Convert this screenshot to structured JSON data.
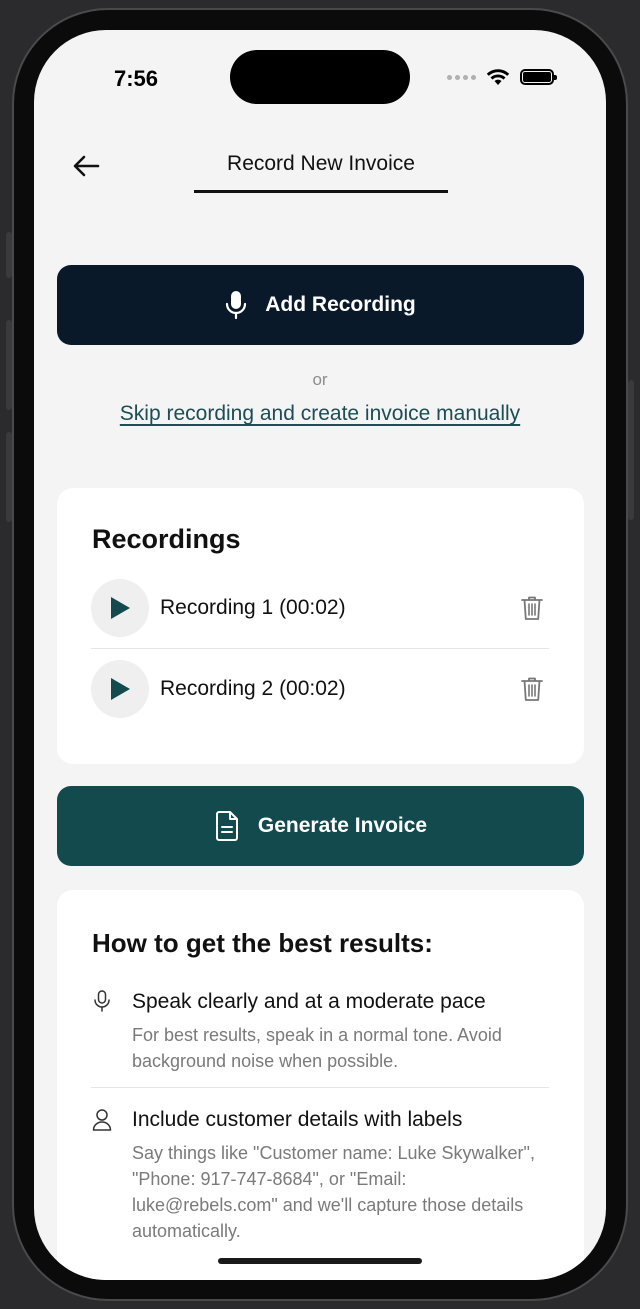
{
  "status_bar": {
    "time": "7:56"
  },
  "header": {
    "title": "Record New Invoice"
  },
  "actions": {
    "add_recording_label": "Add Recording",
    "or_label": "or",
    "skip_label": "Skip recording and create invoice manually",
    "generate_label": "Generate Invoice"
  },
  "recordings": {
    "title": "Recordings",
    "items": [
      {
        "label": "Recording 1 (00:02)"
      },
      {
        "label": "Recording 2 (00:02)"
      }
    ]
  },
  "tips": {
    "title": "How to get the best results:",
    "items": [
      {
        "icon": "microphone-icon",
        "heading": "Speak clearly and at a moderate pace",
        "body": "For best results, speak in a normal tone. Avoid background noise when possible."
      },
      {
        "icon": "person-icon",
        "heading": "Include customer details with labels",
        "body": "Say things like \"Customer name: Luke Skywalker\", \"Phone: 917-747-8684\", or \"Email: luke@rebels.com\" and we'll capture those details automatically."
      }
    ]
  },
  "colors": {
    "primary_dark": "#0a1929",
    "accent_teal": "#124a4e",
    "link": "#1d4d55",
    "background": "#f4f4f4"
  }
}
